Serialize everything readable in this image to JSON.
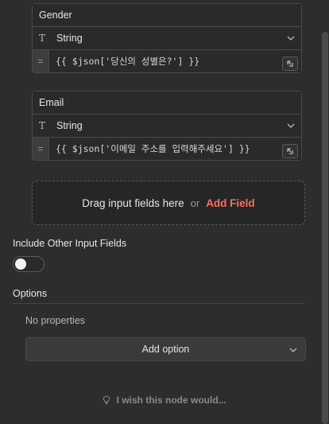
{
  "fields": [
    {
      "name": "Gender",
      "type": "String",
      "type_icon": "T",
      "eq": "=",
      "expression": "{{ $json['당신의 성별은?'] }}"
    },
    {
      "name": "Email",
      "type": "String",
      "type_icon": "T",
      "eq": "=",
      "expression": "{{ $json['이메일 주소를 입력해주세요'] }}"
    }
  ],
  "drop_zone": {
    "text": "Drag input fields here",
    "or": "or",
    "add_field": "Add Field",
    "accent_color": "#ff6d5a"
  },
  "include_other": {
    "label": "Include Other Input Fields",
    "enabled": false
  },
  "options": {
    "label": "Options",
    "empty_text": "No properties",
    "add_option_label": "Add option"
  },
  "feedback": {
    "text": "I wish this node would..."
  }
}
